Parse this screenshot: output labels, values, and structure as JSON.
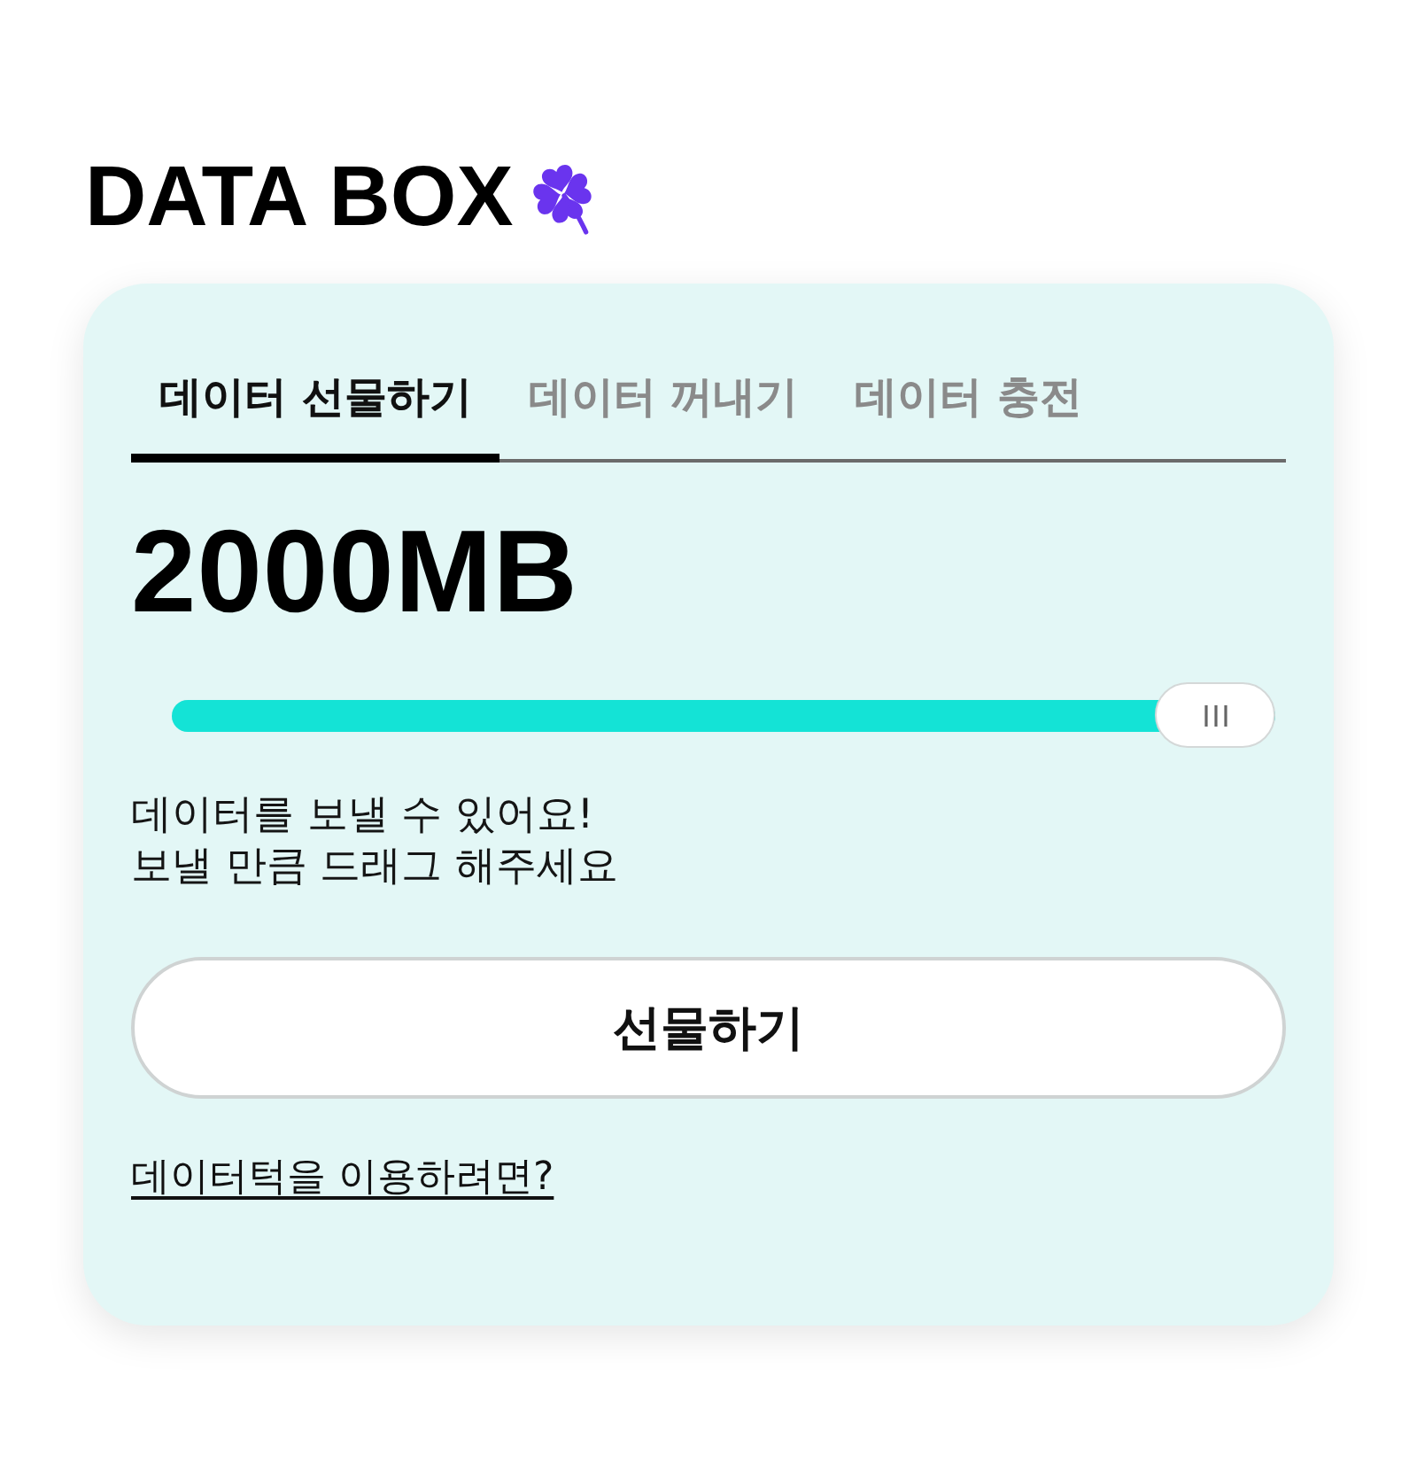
{
  "logo": {
    "text": "DATA BOX"
  },
  "tabs": [
    {
      "label": "데이터 선물하기",
      "selected": true
    },
    {
      "label": "데이터 꺼내기",
      "selected": false
    },
    {
      "label": "데이터 충전",
      "selected": false
    }
  ],
  "amount": "2000MB",
  "slider": {
    "level": 1
  },
  "message": "데이터를 보낼 수 있어요!\n보낼 만큼 드래그 해주세요",
  "button": {
    "label": "선물하기"
  },
  "link": {
    "label": "데이터턱을 이용하려면?"
  }
}
